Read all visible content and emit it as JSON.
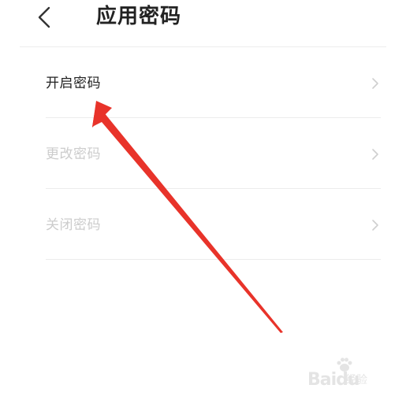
{
  "header": {
    "title": "应用密码",
    "back_icon": "chevron-left-icon"
  },
  "menu": {
    "items": [
      {
        "label": "开启密码",
        "enabled": true,
        "icon": "chevron-right-icon"
      },
      {
        "label": "更改密码",
        "enabled": false,
        "icon": "chevron-right-icon"
      },
      {
        "label": "关闭密码",
        "enabled": false,
        "icon": "chevron-right-icon"
      }
    ]
  },
  "annotation": {
    "color": "#e8332a",
    "icon": "red-arrow-annotation"
  },
  "watermark": {
    "brand": "Bai",
    "brand2": "du",
    "sub": "经验"
  },
  "colors": {
    "text_primary": "#222222",
    "text_disabled": "#cccccc",
    "divider": "#ececec",
    "chevron": "#cfcfcf"
  }
}
